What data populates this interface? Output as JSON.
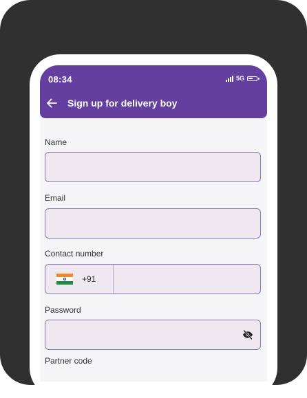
{
  "status_bar": {
    "time": "08:34",
    "network": "5G",
    "signal_icon": "signal-bars-icon",
    "battery_icon": "battery-icon"
  },
  "app_bar": {
    "title": "Sign up for delivery boy",
    "back_icon": "arrow-left-icon",
    "color": "#643f9f"
  },
  "form": {
    "name_label": "Name",
    "name_value": "",
    "email_label": "Email",
    "email_value": "",
    "contact_label": "Contact number",
    "country_flag_icon": "india-flag-icon",
    "dial_code": "+91",
    "contact_value": "",
    "password_label": "Password",
    "password_value": "",
    "password_toggle_icon": "eye-off-icon",
    "partner_label": "Partner code"
  }
}
